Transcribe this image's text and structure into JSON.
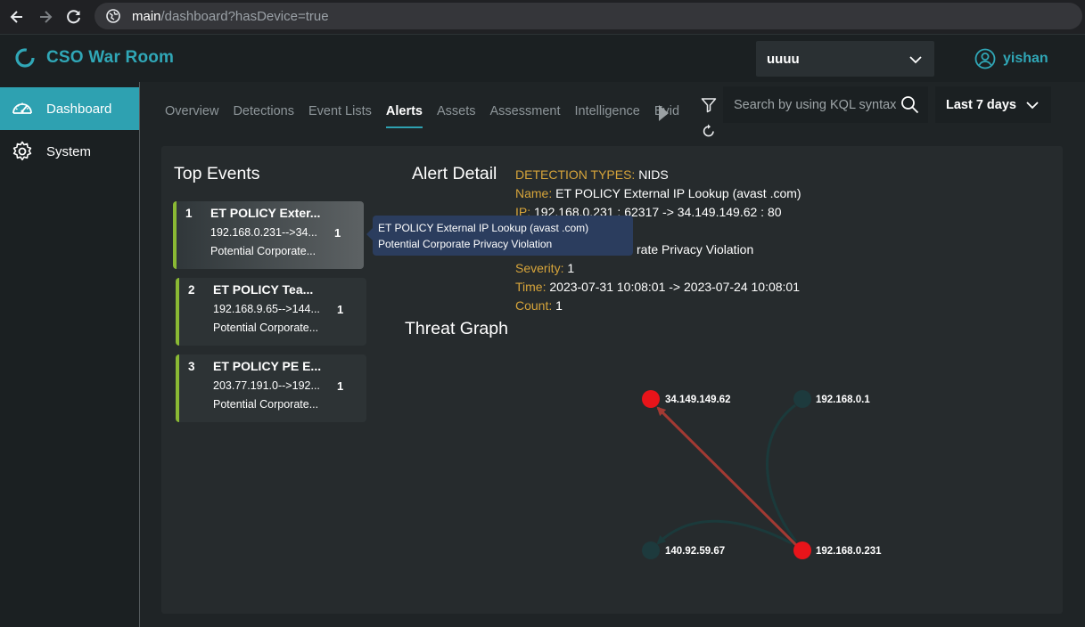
{
  "browser": {
    "url_host": "main",
    "url_path": "/dashboard?hasDevice=true"
  },
  "header": {
    "title": "CSO War Room",
    "org_select": "uuuu",
    "user_name": "yishan"
  },
  "sidebar": {
    "items": [
      {
        "label": "Dashboard",
        "icon": "speedometer-icon",
        "active": true
      },
      {
        "label": "System",
        "icon": "gear-icon",
        "active": false
      }
    ]
  },
  "tabs": [
    {
      "label": "Overview",
      "active": false
    },
    {
      "label": "Detections",
      "active": false
    },
    {
      "label": "Event Lists",
      "active": false
    },
    {
      "label": "Alerts",
      "active": true
    },
    {
      "label": "Assets",
      "active": false
    },
    {
      "label": "Assessment",
      "active": false
    },
    {
      "label": "Intelligence",
      "active": false
    },
    {
      "label": "Evider",
      "active": false
    }
  ],
  "search": {
    "placeholder": "Search by using KQL syntax"
  },
  "time_range": "Last 7 days",
  "top_events": {
    "title": "Top Events",
    "items": [
      {
        "rank": "1",
        "title": "ET POLICY Exter...",
        "ip": "192.168.0.231-->34...",
        "category": "Potential Corporate...",
        "count": "1"
      },
      {
        "rank": "2",
        "title": "ET POLICY Tea...",
        "ip": "192.168.9.65-->144...",
        "category": "Potential Corporate...",
        "count": "1"
      },
      {
        "rank": "3",
        "title": "ET POLICY PE E...",
        "ip": "203.77.191.0-->192...",
        "category": "Potential Corporate...",
        "count": "1"
      }
    ]
  },
  "tooltip": {
    "line1": "ET POLICY External IP Lookup (avast .com)",
    "line2": "Potential Corporate Privacy Violation"
  },
  "alert_detail": {
    "title": "Alert Detail",
    "detection_types_key": "DETECTION TYPES:",
    "detection_types_val": "NIDS",
    "name_key": "Name:",
    "name_val": "ET POLICY External IP Lookup (avast .com)",
    "ip_key": "IP:",
    "ip_val": "192.168.0.231 : 62317 -> 34.149.149.62 : 80",
    "category_val": "rate Privacy Violation",
    "severity_key": "Severity:",
    "severity_val": "1",
    "time_key": "Time:",
    "time_val": "2023-07-31 10:08:01 -> 2023-07-24 10:08:01",
    "count_key": "Count:",
    "count_val": "1"
  },
  "threat_graph": {
    "title": "Threat Graph",
    "nodes": [
      {
        "label": "34.149.149.62",
        "status": "alert",
        "color": "#e8141a"
      },
      {
        "label": "192.168.0.1",
        "status": "normal",
        "color": "#1d3a3d"
      },
      {
        "label": "140.92.59.67",
        "status": "normal",
        "color": "#1d3a3d"
      },
      {
        "label": "192.168.0.231",
        "status": "alert",
        "color": "#e8141a"
      }
    ],
    "edges": [
      {
        "from": "192.168.0.231",
        "to": "34.149.149.62",
        "color": "#a23a33"
      },
      {
        "from": "192.168.0.231",
        "to": "192.168.0.1",
        "color": "#1b3a3b"
      },
      {
        "from": "192.168.0.231",
        "to": "140.92.59.67",
        "color": "#1b3a3b"
      }
    ]
  },
  "colors": {
    "accent": "#2ea1b1",
    "highlight_key": "#d6a43a",
    "card_bar": "#8ab934"
  }
}
